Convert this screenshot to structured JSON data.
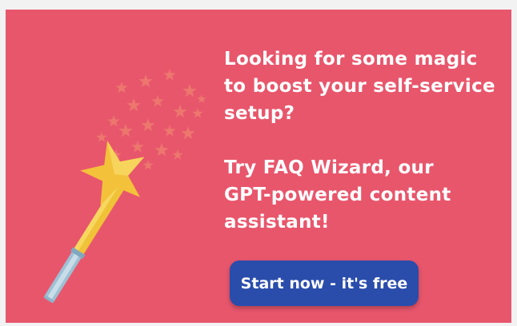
{
  "banner": {
    "headline": "Looking for some magic\nto boost your self-service\nsetup?\n\nTry FAQ Wizard, our\nGPT-powered content\nassistant!",
    "cta_label": "Start now - it's free",
    "background_color": "#e8566c",
    "button_color": "#2a4dab",
    "illustration_icon": "magic-wand-icon"
  }
}
